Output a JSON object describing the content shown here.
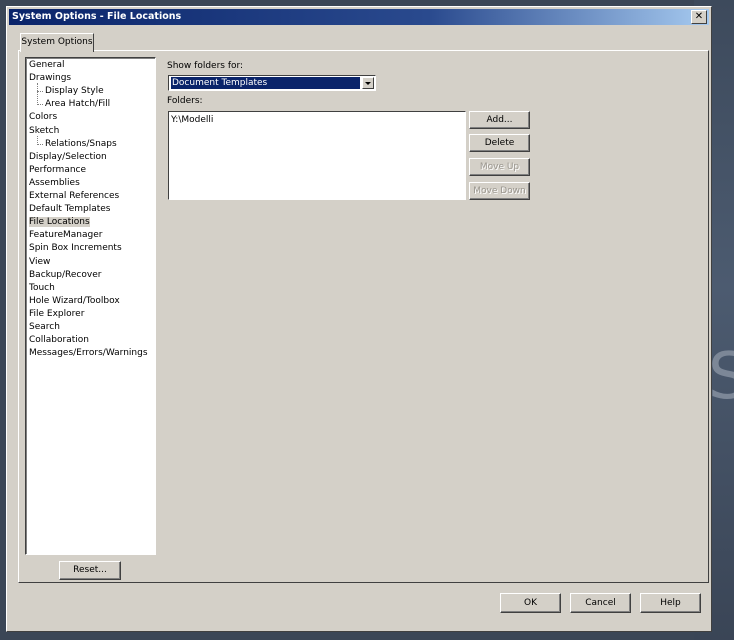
{
  "window": {
    "title": "System Options - File Locations",
    "close_glyph": "✕"
  },
  "tab": {
    "label": "System Options"
  },
  "tree": {
    "items": [
      {
        "label": "General",
        "level": 0
      },
      {
        "label": "Drawings",
        "level": 0
      },
      {
        "label": "Display Style",
        "level": 1
      },
      {
        "label": "Area Hatch/Fill",
        "level": 1
      },
      {
        "label": "Colors",
        "level": 0
      },
      {
        "label": "Sketch",
        "level": 0
      },
      {
        "label": "Relations/Snaps",
        "level": 1
      },
      {
        "label": "Display/Selection",
        "level": 0
      },
      {
        "label": "Performance",
        "level": 0
      },
      {
        "label": "Assemblies",
        "level": 0
      },
      {
        "label": "External References",
        "level": 0
      },
      {
        "label": "Default Templates",
        "level": 0
      },
      {
        "label": "File Locations",
        "level": 0,
        "selected": true
      },
      {
        "label": "FeatureManager",
        "level": 0
      },
      {
        "label": "Spin Box Increments",
        "level": 0
      },
      {
        "label": "View",
        "level": 0
      },
      {
        "label": "Backup/Recover",
        "level": 0
      },
      {
        "label": "Touch",
        "level": 0
      },
      {
        "label": "Hole Wizard/Toolbox",
        "level": 0
      },
      {
        "label": "File Explorer",
        "level": 0
      },
      {
        "label": "Search",
        "level": 0
      },
      {
        "label": "Collaboration",
        "level": 0
      },
      {
        "label": "Messages/Errors/Warnings",
        "level": 0
      }
    ]
  },
  "reset_label": "Reset...",
  "show_folders": {
    "label": "Show folders for:",
    "value": "Document Templates"
  },
  "folders": {
    "label": "Folders:",
    "items": [
      "Y:\\Modelli"
    ]
  },
  "buttons": {
    "add": "Add...",
    "delete": "Delete",
    "move_up": "Move Up",
    "move_down": "Move Down",
    "ok": "OK",
    "cancel": "Cancel",
    "help": "Help"
  },
  "desktop": {
    "letter": "S"
  }
}
